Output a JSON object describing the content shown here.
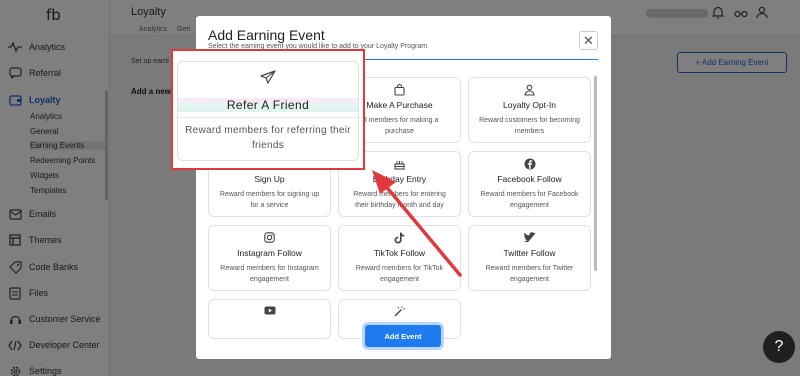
{
  "app": {
    "logo": "fb"
  },
  "sidebar": {
    "items": [
      {
        "label": "Analytics",
        "icon": "activity-icon"
      },
      {
        "label": "Referral",
        "icon": "chat-icon"
      },
      {
        "label": "Loyalty",
        "icon": "wallet-icon"
      },
      {
        "label": "Emails",
        "icon": "mail-icon"
      },
      {
        "label": "Themes",
        "icon": "themes-icon"
      },
      {
        "label": "Code Banks",
        "icon": "tag-icon"
      },
      {
        "label": "Files",
        "icon": "file-icon"
      },
      {
        "label": "Customer Service",
        "icon": "headset-icon"
      },
      {
        "label": "Developer Center",
        "icon": "code-icon"
      },
      {
        "label": "Settings",
        "icon": "gear-icon"
      }
    ],
    "loyalty_subitems": [
      "Analytics",
      "General",
      "Earning Events",
      "Redeeming Points",
      "Widgets",
      "Templates"
    ]
  },
  "header": {
    "title": "Loyalty",
    "tabs": [
      "Analytics",
      "Gen"
    ]
  },
  "main": {
    "setup_text": "Set up earni",
    "add_new_text": "Add a new",
    "add_earning_button": "+ Add Earning Event"
  },
  "modal": {
    "title": "Add Earning Event",
    "subtitle": "Select the earning event you would like to add to your Loyalty Program",
    "close_symbol": "✕",
    "cards": [
      {
        "title": "",
        "description": "",
        "icon": "send-icon"
      },
      {
        "title": "Make A Purchase",
        "description": "rd members for making a purchase",
        "icon": "bag-icon"
      },
      {
        "title": "Loyalty Opt-In",
        "description": "Reward customers for becoming members",
        "icon": "user-icon"
      },
      {
        "title": "Sign Up",
        "description": "Reward members for signing up for a service",
        "icon": "user-add-icon"
      },
      {
        "title": "Birthday Entry",
        "description": "Reward members for entering their birthday month and day",
        "icon": "cake-icon"
      },
      {
        "title": "Facebook Follow",
        "description": "Reward members for Facebook engagement",
        "icon": "facebook-icon"
      },
      {
        "title": "Instagram Follow",
        "description": "Reward members for Instagram engagement",
        "icon": "instagram-icon"
      },
      {
        "title": "TikTok Follow",
        "description": "Reward members for TikTok engagement",
        "icon": "tiktok-icon"
      },
      {
        "title": "Twitter Follow",
        "description": "Reward members for Twitter engagement",
        "icon": "twitter-icon"
      },
      {
        "title": "",
        "description": "",
        "icon": "youtube-icon"
      },
      {
        "title": "",
        "description": "",
        "icon": "magic-wand-icon"
      }
    ],
    "add_event_button": "Add Event"
  },
  "callout": {
    "title": "Refer A Friend",
    "description": "Reward members for referring their friends",
    "icon": "send-icon",
    "accent": "#e0393e"
  },
  "help": {
    "symbol": "?"
  }
}
